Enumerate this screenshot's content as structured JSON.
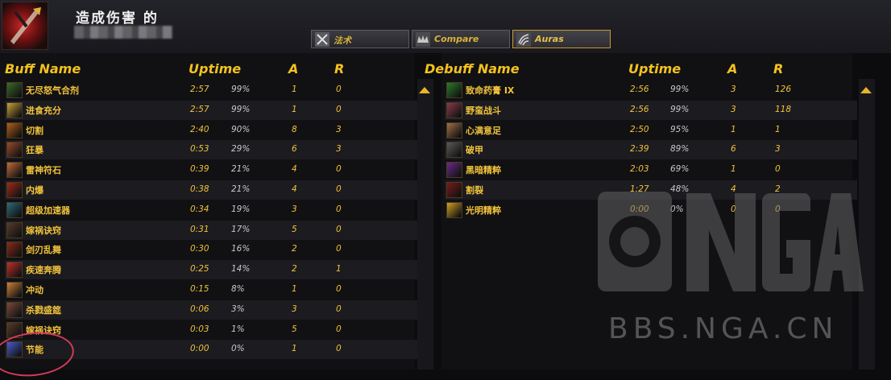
{
  "header": {
    "title": "造成伤害 的",
    "tabs": [
      {
        "label": "法术",
        "icon": "crossed-swords-icon"
      },
      {
        "label": "Compare",
        "icon": "crown-icon"
      },
      {
        "label": "Auras",
        "icon": "claw-icon"
      }
    ],
    "active_tab": "Auras"
  },
  "buffs": {
    "headers": {
      "name": "Buff Name",
      "uptime": "Uptime",
      "a": "A",
      "r": "R"
    },
    "rows": [
      {
        "name": "无尽怒气合剂",
        "time": "2:57",
        "pct": "99%",
        "a": "1",
        "r": "0",
        "icon_color": "#3a6a2a"
      },
      {
        "name": "进食充分",
        "time": "2:57",
        "pct": "99%",
        "a": "1",
        "r": "0",
        "icon_color": "#c9a13a"
      },
      {
        "name": "切割",
        "time": "2:40",
        "pct": "90%",
        "a": "8",
        "r": "3",
        "icon_color": "#b0601a"
      },
      {
        "name": "狂暴",
        "time": "0:53",
        "pct": "29%",
        "a": "6",
        "r": "3",
        "icon_color": "#9a4a2a"
      },
      {
        "name": "雷神符石",
        "time": "0:39",
        "pct": "21%",
        "a": "4",
        "r": "0",
        "icon_color": "#c26a3a"
      },
      {
        "name": "内爆",
        "time": "0:38",
        "pct": "21%",
        "a": "4",
        "r": "0",
        "icon_color": "#a02a1a"
      },
      {
        "name": "超级加速器",
        "time": "0:34",
        "pct": "19%",
        "a": "3",
        "r": "0",
        "icon_color": "#2a6a7a"
      },
      {
        "name": "嫁祸诀窍",
        "time": "0:31",
        "pct": "17%",
        "a": "5",
        "r": "0",
        "icon_color": "#5a3a2a"
      },
      {
        "name": "剑刃乱舞",
        "time": "0:30",
        "pct": "16%",
        "a": "2",
        "r": "0",
        "icon_color": "#8a2a1a"
      },
      {
        "name": "疾速奔腾",
        "time": "0:25",
        "pct": "14%",
        "a": "2",
        "r": "1",
        "icon_color": "#c0302a"
      },
      {
        "name": "冲动",
        "time": "0:15",
        "pct": "8%",
        "a": "1",
        "r": "0",
        "icon_color": "#d0803a"
      },
      {
        "name": "杀戮盛筵",
        "time": "0:06",
        "pct": "3%",
        "a": "3",
        "r": "0",
        "icon_color": "#7a4a3a"
      },
      {
        "name": "嫁祸诀窍",
        "time": "0:03",
        "pct": "1%",
        "a": "5",
        "r": "0",
        "icon_color": "#5a3a2a"
      },
      {
        "name": "节能",
        "time": "0:00",
        "pct": "0%",
        "a": "1",
        "r": "0",
        "icon_color": "#4a5ad0"
      }
    ]
  },
  "debuffs": {
    "headers": {
      "name": "Debuff Name",
      "uptime": "Uptime",
      "a": "A",
      "r": "R"
    },
    "rows": [
      {
        "name": "致命药膏 IX",
        "time": "2:56",
        "pct": "99%",
        "a": "3",
        "r": "126",
        "icon_color": "#2a7a2a"
      },
      {
        "name": "野蛮战斗",
        "time": "2:56",
        "pct": "99%",
        "a": "3",
        "r": "118",
        "icon_color": "#8a3a4a"
      },
      {
        "name": "心满意足",
        "time": "2:50",
        "pct": "95%",
        "a": "1",
        "r": "1",
        "icon_color": "#a0704a"
      },
      {
        "name": "破甲",
        "time": "2:39",
        "pct": "89%",
        "a": "6",
        "r": "3",
        "icon_color": "#5a5a5a"
      },
      {
        "name": "黑暗精粹",
        "time": "2:03",
        "pct": "69%",
        "a": "1",
        "r": "0",
        "icon_color": "#6a2a8a"
      },
      {
        "name": "割裂",
        "time": "1:27",
        "pct": "48%",
        "a": "4",
        "r": "2",
        "icon_color": "#7a1a1a"
      },
      {
        "name": "光明精粹",
        "time": "0:00",
        "pct": "0%",
        "a": "0",
        "r": "0",
        "icon_color": "#d0a020"
      }
    ]
  },
  "watermark": {
    "logo": "NGA",
    "url": "BBS.NGA.CN"
  },
  "colors": {
    "header_gold": "#f4c21e",
    "text_gold": "#f2c33a",
    "highlight_circle": "#d23a5a"
  }
}
